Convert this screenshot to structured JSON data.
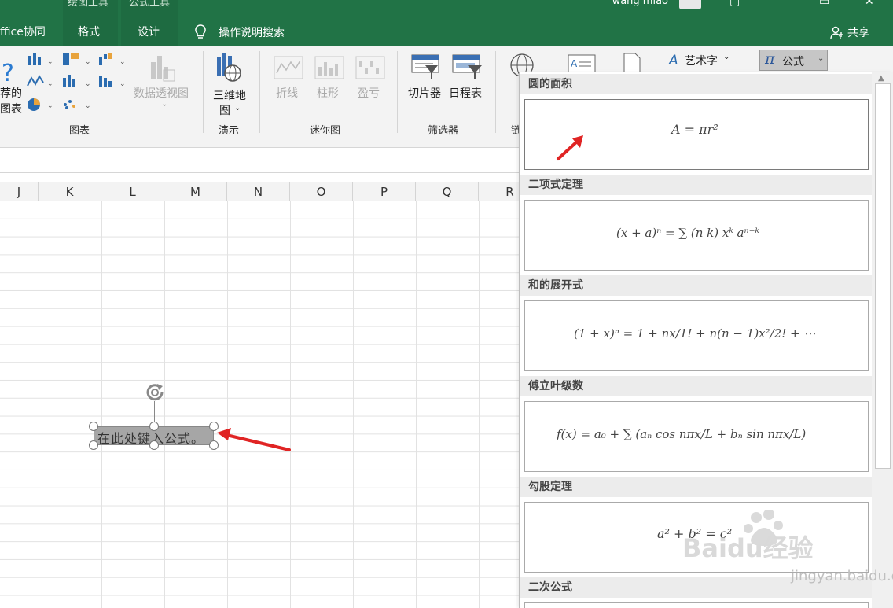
{
  "titlebar": {
    "context_label_1": "绘图工具",
    "context_label_2": "公式工具",
    "tabs": [
      "ffice协同",
      "格式",
      "设计"
    ],
    "tell_me": "操作说明搜索",
    "user": "wang miao",
    "share": "共享"
  },
  "ribbon": {
    "charts_group": {
      "recommended_line1": "荐的",
      "recommended_line2": "图表",
      "pivot_chart": "数据透视图",
      "label": "图表"
    },
    "tours_group": {
      "map_line1": "三维地",
      "map_line2": "图",
      "label": "演示"
    },
    "sparklines_group": {
      "items": [
        "折线",
        "柱形",
        "盈亏"
      ],
      "label": "迷你图"
    },
    "filters_group": {
      "items": [
        "切片器",
        "日程表"
      ],
      "label": "筛选器"
    },
    "links_group_label": "链",
    "wordart": "艺术字",
    "equation_button": "公式",
    "equation_symbol": "π"
  },
  "sheet": {
    "columns": [
      "J",
      "K",
      "L",
      "M",
      "N",
      "O",
      "P",
      "Q",
      "R"
    ],
    "equation_placeholder": "在此处键入公式。"
  },
  "gallery": {
    "sections": [
      {
        "title": "圆的面积",
        "formula": "A = πr²"
      },
      {
        "title": "二项式定理",
        "formula": "(x + a)ⁿ = ∑ (n k) xᵏ aⁿ⁻ᵏ"
      },
      {
        "title": "和的展开式",
        "formula": "(1 + x)ⁿ = 1 + nx/1! + n(n − 1)x²/2! + ⋯"
      },
      {
        "title": "傅立叶级数",
        "formula": "f(x) = a₀ + ∑ (aₙ cos nπx/L + bₙ sin nπx/L)"
      },
      {
        "title": "勾股定理",
        "formula": "a² + b² = c²"
      },
      {
        "title": "二次公式",
        "formula": ""
      }
    ]
  },
  "watermark": {
    "brand": "Baidu经验",
    "url": "jingyan.baidu.com"
  },
  "colors": {
    "excel_green": "#217346",
    "annotation_red": "#e02424"
  }
}
